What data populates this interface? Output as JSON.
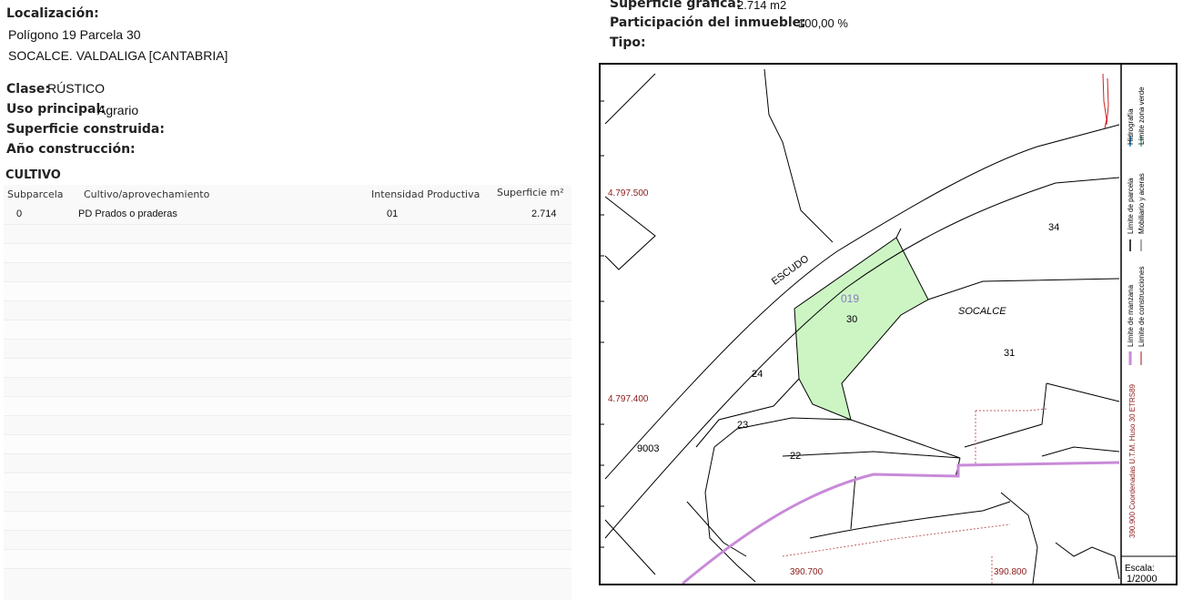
{
  "left": {
    "localizacion_label": "Localización:",
    "address_line1": "Polígono 19 Parcela 30",
    "address_line2": "SOCALCE. VALDALIGA [CANTABRIA]",
    "clase_label": "Clase:",
    "clase_value": "RÚSTICO",
    "uso_label": "Uso principal:",
    "uso_value": "Agrario",
    "sup_construida_label": "Superficie construida:",
    "anio_label": "Año construcción:",
    "cultivo_title": "CULTIVO",
    "table": {
      "headers": [
        "Subparcela",
        "Cultivo/aprovechamiento",
        "Intensidad Productiva",
        "Superficie m²"
      ],
      "rows": [
        [
          "0",
          "PD Prados o praderas",
          "01",
          "2.714"
        ]
      ]
    }
  },
  "right": {
    "sup_grafica_label": "Superficie gráfica:",
    "sup_grafica_value": "2.714 m2",
    "participacion_label": "Participación del inmueble:",
    "participacion_value": "100,00 %",
    "tipo_label": "Tipo:"
  },
  "map": {
    "coord_y1": "4.797.500",
    "coord_y2": "4.797.400",
    "coord_x1": "390.700",
    "coord_x2": "390.800",
    "street_label": "ESCUDO",
    "parcel_code": "019",
    "parcel_30": "30",
    "parcel_34": "34",
    "parcel_31": "31",
    "parcel_24": "24",
    "parcel_23": "23",
    "parcel_22": "22",
    "parcel_9003": "9003",
    "place_label": "SOCALCE",
    "legend": {
      "hidrografia": "Hidrografía",
      "limite_zona_verde": "Límite zona verde",
      "limite_parcela": "Límite de parcela",
      "mobiliario": "Mobiliario y aceras",
      "limite_manzana": "Límite de manzana",
      "limite_construcciones": "Límite de construcciones",
      "coordenadas": "390.900 Coordenadas U.T.M. Huso 30 ETRS89"
    },
    "escala_label": "Escala:",
    "escala_value": "1/2000",
    "colors": {
      "parcel_fill": "#ccf5c3",
      "block_line": "#c88ad8",
      "coord_text": "#8b1a1a",
      "parcel_code": "#8a7ac8"
    }
  }
}
